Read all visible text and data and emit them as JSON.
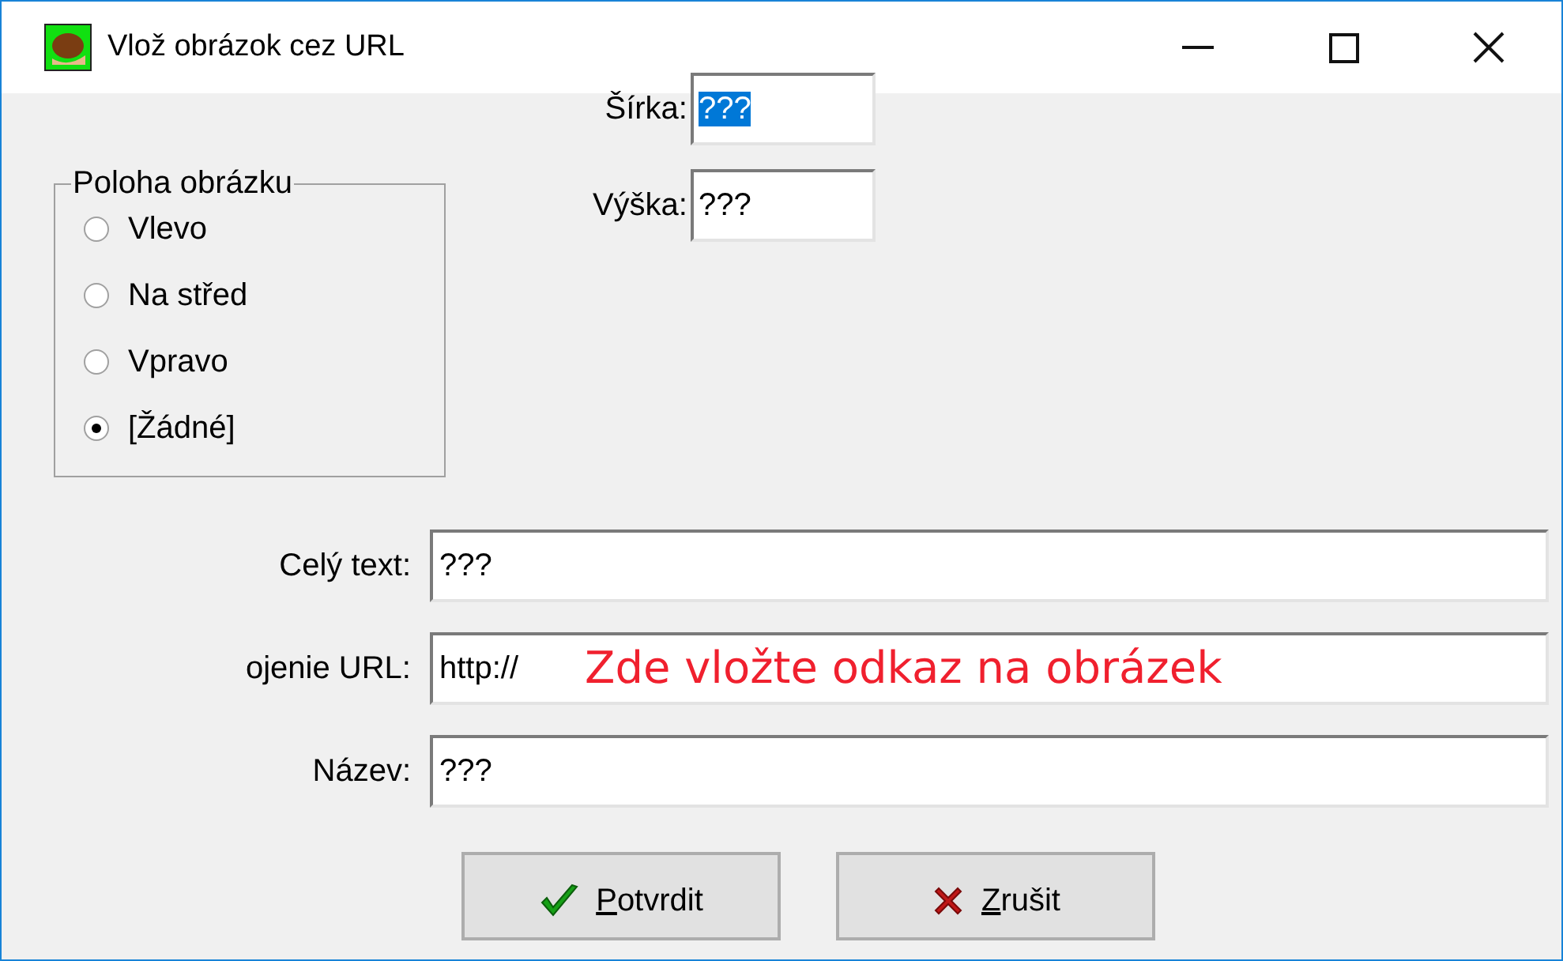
{
  "window": {
    "title": "Vlož obrázok cez URL"
  },
  "position_group": {
    "title": "Poloha obrázku",
    "options": [
      {
        "label": "Vlevo",
        "selected": false
      },
      {
        "label": "Na střed",
        "selected": false
      },
      {
        "label": "Vpravo",
        "selected": false
      },
      {
        "label": "[Žádné]",
        "selected": true
      }
    ]
  },
  "size_fields": [
    {
      "label": "Šírka:",
      "value": "???",
      "text_selected": true
    },
    {
      "label": "Výška:",
      "value": "???",
      "text_selected": false
    }
  ],
  "fields": [
    {
      "label": "Celý text:",
      "value": "???"
    },
    {
      "label": "ojenie URL:",
      "value": "http://",
      "annotation": "Zde vložte odkaz na obrázek"
    },
    {
      "label": "Název:",
      "value": "???"
    }
  ],
  "buttons": [
    {
      "kind": "confirm",
      "mnemonic": "P",
      "label": "otvrdit"
    },
    {
      "kind": "cancel",
      "mnemonic": "Z",
      "label": "rušit"
    }
  ]
}
